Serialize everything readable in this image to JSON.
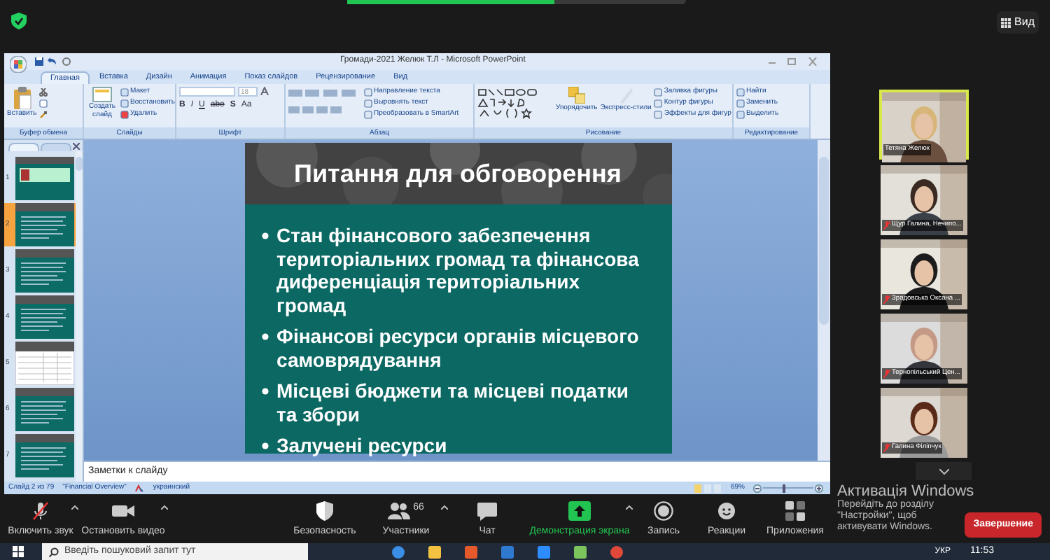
{
  "top_bar": {
    "view_button": "Вид"
  },
  "powerpoint": {
    "title": "Громади-2021 Желюк Т.Л - Microsoft PowerPoint",
    "tabs": [
      {
        "label": "Главная",
        "selected": true
      },
      {
        "label": "Вставка",
        "selected": false
      },
      {
        "label": "Дизайн",
        "selected": false
      },
      {
        "label": "Анимация",
        "selected": false
      },
      {
        "label": "Показ слайдов",
        "selected": false
      },
      {
        "label": "Рецензирование",
        "selected": false
      },
      {
        "label": "Вид",
        "selected": false
      }
    ],
    "ribbon_groups": [
      {
        "kind": "clipboard",
        "label": "Буфер обмена",
        "buttons": [
          "Вставить"
        ]
      },
      {
        "kind": "slides",
        "label": "Слайды",
        "buttons": [
          "Создать слайд",
          "Макет",
          "Восстановить",
          "Удалить"
        ]
      },
      {
        "kind": "font",
        "label": "Шрифт",
        "font_size": "18",
        "buttons": [
          "B",
          "I",
          "U",
          "abe",
          "S",
          "Aa"
        ]
      },
      {
        "kind": "paragraph",
        "label": "Абзац",
        "buttons": [
          "Направление текста",
          "Выровнять текст",
          "Преобразовать в SmartArt"
        ]
      },
      {
        "kind": "drawing",
        "label": "Рисование",
        "buttons": [
          "Упорядочить",
          "Экспресс-стили",
          "Заливка фигуры",
          "Контур фигуры",
          "Эффекты для фигур"
        ]
      },
      {
        "kind": "editing",
        "label": "Редактирование",
        "buttons": [
          "Найти",
          "Заменить",
          "Выделить"
        ]
      }
    ],
    "slides": [
      {
        "number": "1",
        "kind": "title",
        "selected": false
      },
      {
        "number": "2",
        "kind": "text",
        "selected": true
      },
      {
        "number": "3",
        "kind": "text",
        "selected": false
      },
      {
        "number": "4",
        "kind": "text",
        "selected": false
      },
      {
        "number": "5",
        "kind": "table",
        "selected": false
      },
      {
        "number": "6",
        "kind": "text",
        "selected": false
      },
      {
        "number": "7",
        "kind": "text",
        "selected": false
      }
    ],
    "slide": {
      "title": "Питання для обговорення",
      "bullets": [
        "Стан фінансового забезпечення територіальних громад та фінансова диференціація територіальних громад",
        "Фінансові ресурси органів місцевого самоврядування",
        "Місцеві бюджети та місцеві податки та збори",
        "Залучені ресурси"
      ]
    },
    "notes_placeholder": "Заметки к слайду",
    "status_bar": {
      "slide_position": "Слайд 2 из 79",
      "theme": "\"Financial Overview\"",
      "language": "украинский",
      "zoom": "69%",
      "zoom_slider": {
        "level": 0.4
      }
    }
  },
  "participants": [
    {
      "name": "Тетяна Желюк",
      "muted": false,
      "speaking": true
    },
    {
      "name": "Щур Галина, Нечипо...",
      "muted": true,
      "speaking": false
    },
    {
      "name": "Зрадовська Оксана ...",
      "muted": true,
      "speaking": false
    },
    {
      "name": "Тернопільський Цен...",
      "muted": true,
      "speaking": false
    },
    {
      "name": "Галина Філіпчук",
      "muted": true,
      "speaking": false
    }
  ],
  "toolbar": [
    {
      "kind": "mic",
      "label": "Включить звук",
      "menu": true,
      "active": false
    },
    {
      "kind": "video",
      "label": "Остановить видео",
      "menu": true,
      "active": false
    },
    {
      "kind": "security",
      "label": "Безопасность",
      "menu": false,
      "active": false
    },
    {
      "kind": "participants",
      "label": "Участники",
      "count": "66",
      "menu": true,
      "active": false
    },
    {
      "kind": "chat",
      "label": "Чат",
      "menu": false,
      "active": false
    },
    {
      "kind": "share",
      "label": "Демонстрация экрана",
      "menu": true,
      "active": true
    },
    {
      "kind": "record",
      "label": "Запись",
      "menu": false,
      "active": false
    },
    {
      "kind": "reactions",
      "label": "Реакции",
      "menu": false,
      "active": false
    },
    {
      "kind": "apps",
      "label": "Приложения",
      "menu": false,
      "active": false
    }
  ],
  "end_button": "Завершение",
  "windows_activation": {
    "title": "Активація Windows",
    "text": "Перейдіть до розділу \"Настройки\", щоб активувати Windows."
  },
  "taskbar": {
    "search_placeholder": "Введіть пошуковий запит тут",
    "language": "УКР",
    "time": "11:53"
  }
}
